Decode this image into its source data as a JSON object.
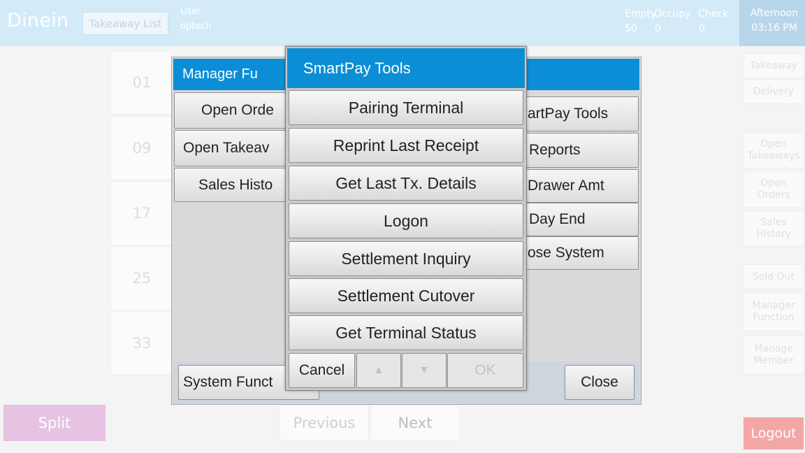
{
  "header": {
    "mode": "Dinein",
    "takeaway_list": "Takeaway List",
    "user_label": "User",
    "user_name": "optech",
    "counts": [
      {
        "label": "Empty",
        "value": "50"
      },
      {
        "label": "Occupy",
        "value": "0"
      },
      {
        "label": "Check",
        "value": "0"
      }
    ],
    "time_of_day": "Afternoon",
    "clock": "03:16 PM"
  },
  "sidebar": {
    "buttons": [
      "Takeaway",
      "Delivery",
      "Open Takeaways",
      "Open Orders",
      "Sales History",
      "Sold Out",
      "Manager Function",
      "Manage Member"
    ],
    "logout": "Logout"
  },
  "tables": [
    "01",
    "09",
    "17",
    "25",
    "33"
  ],
  "bottom": {
    "split": "Split",
    "previous": "Previous",
    "next": "Next"
  },
  "manager_dialog": {
    "title": "Manager Fu",
    "left_buttons": [
      "Open Orde",
      "Open Takeav",
      "Sales Histo"
    ],
    "right_buttons": [
      "artPay Tools",
      "Reports",
      "Drawer Amt",
      "Day End",
      "ose System"
    ],
    "system_function": "System Funct",
    "close": "Close"
  },
  "smartpay_dialog": {
    "title": "SmartPay Tools",
    "buttons": [
      "Pairing Terminal",
      "Reprint Last Receipt",
      "Get Last Tx. Details",
      "Logon",
      "Settlement Inquiry",
      "Settlement Cutover",
      "Get Terminal Status"
    ],
    "cancel": "Cancel",
    "up": "▲",
    "down": "▼",
    "ok": "OK"
  }
}
